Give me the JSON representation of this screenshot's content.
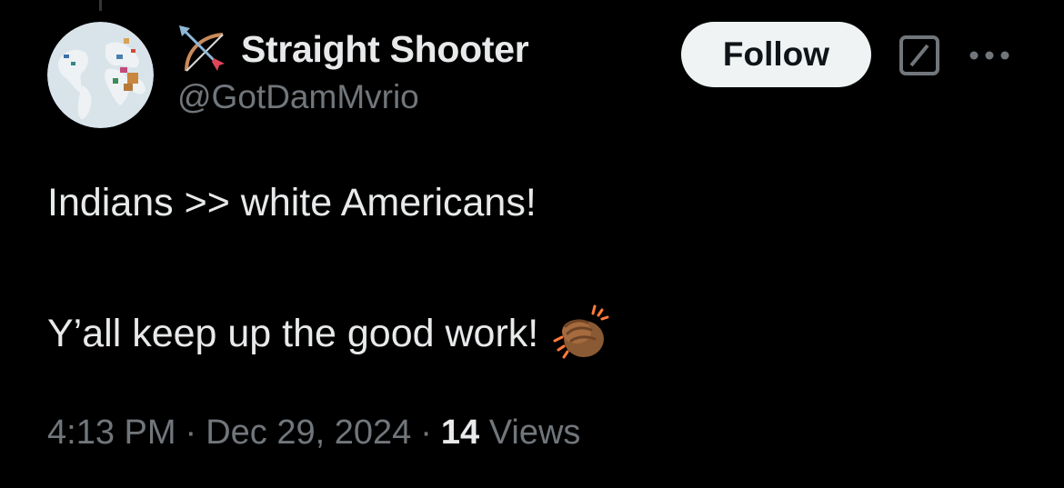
{
  "user": {
    "display_name": "Straight Shooter",
    "handle": "@GotDamMvrio",
    "avatar_icon": "globe-map-avatar",
    "name_prefix_icon": "bow-and-arrow-icon"
  },
  "actions": {
    "follow_label": "Follow",
    "grok_icon": "grok-icon",
    "more_icon": "more-horizontal-icon"
  },
  "tweet": {
    "line1": "Indians >> white Americans!",
    "line2": "Y’all keep up the good work!",
    "emoji": "clapping-hands-medium-dark-skin-tone"
  },
  "meta": {
    "time": "4:13 PM",
    "separator": "·",
    "date": "Dec 29, 2024",
    "view_count": "14",
    "views_label": "Views"
  },
  "colors": {
    "background": "#000000",
    "primary_text": "#e7e9ea",
    "secondary_text": "#71767b",
    "follow_bg": "#eff3f4"
  }
}
